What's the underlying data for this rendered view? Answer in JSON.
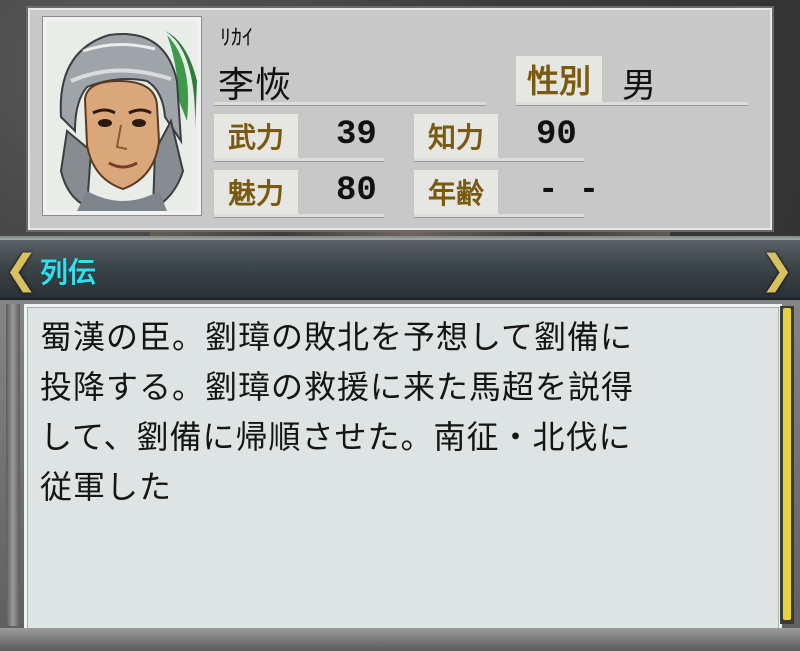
{
  "profile": {
    "reading": "ﾘｶｲ",
    "name": "李恢",
    "gender_label": "性別",
    "gender_value": "男",
    "stats": [
      {
        "label": "武力",
        "value": "39"
      },
      {
        "label": "知力",
        "value": "90"
      },
      {
        "label": "魅力",
        "value": "80"
      },
      {
        "label": "年齢",
        "value": "- -"
      }
    ]
  },
  "biography": {
    "title": "列伝",
    "prev_icon": "chevron-left-icon",
    "next_icon": "chevron-right-icon",
    "lines": [
      "蜀漢の臣。劉璋の敗北を予想して劉備に",
      "投降する。劉璋の救援に来た馬超を説得",
      "して、劉備に帰順させた。南征・北伐に",
      "従軍した"
    ]
  },
  "colors": {
    "label_text": "#7a5a10",
    "bio_title": "#30e0f0",
    "arrow": "#d8c060",
    "scroll_thumb": "#e8d23a"
  }
}
